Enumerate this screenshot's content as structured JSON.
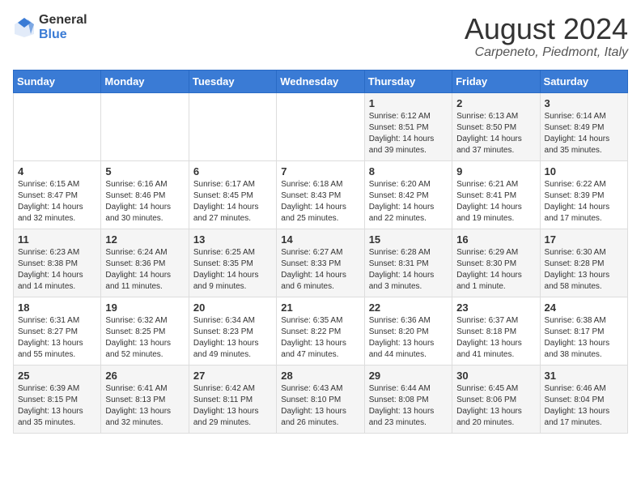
{
  "logo": {
    "general": "General",
    "blue": "Blue"
  },
  "title": {
    "month_year": "August 2024",
    "location": "Carpeneto, Piedmont, Italy"
  },
  "days_of_week": [
    "Sunday",
    "Monday",
    "Tuesday",
    "Wednesday",
    "Thursday",
    "Friday",
    "Saturday"
  ],
  "weeks": [
    [
      {
        "date": "",
        "info": ""
      },
      {
        "date": "",
        "info": ""
      },
      {
        "date": "",
        "info": ""
      },
      {
        "date": "",
        "info": ""
      },
      {
        "date": "1",
        "info": "Sunrise: 6:12 AM\nSunset: 8:51 PM\nDaylight: 14 hours\nand 39 minutes."
      },
      {
        "date": "2",
        "info": "Sunrise: 6:13 AM\nSunset: 8:50 PM\nDaylight: 14 hours\nand 37 minutes."
      },
      {
        "date": "3",
        "info": "Sunrise: 6:14 AM\nSunset: 8:49 PM\nDaylight: 14 hours\nand 35 minutes."
      }
    ],
    [
      {
        "date": "4",
        "info": "Sunrise: 6:15 AM\nSunset: 8:47 PM\nDaylight: 14 hours\nand 32 minutes."
      },
      {
        "date": "5",
        "info": "Sunrise: 6:16 AM\nSunset: 8:46 PM\nDaylight: 14 hours\nand 30 minutes."
      },
      {
        "date": "6",
        "info": "Sunrise: 6:17 AM\nSunset: 8:45 PM\nDaylight: 14 hours\nand 27 minutes."
      },
      {
        "date": "7",
        "info": "Sunrise: 6:18 AM\nSunset: 8:43 PM\nDaylight: 14 hours\nand 25 minutes."
      },
      {
        "date": "8",
        "info": "Sunrise: 6:20 AM\nSunset: 8:42 PM\nDaylight: 14 hours\nand 22 minutes."
      },
      {
        "date": "9",
        "info": "Sunrise: 6:21 AM\nSunset: 8:41 PM\nDaylight: 14 hours\nand 19 minutes."
      },
      {
        "date": "10",
        "info": "Sunrise: 6:22 AM\nSunset: 8:39 PM\nDaylight: 14 hours\nand 17 minutes."
      }
    ],
    [
      {
        "date": "11",
        "info": "Sunrise: 6:23 AM\nSunset: 8:38 PM\nDaylight: 14 hours\nand 14 minutes."
      },
      {
        "date": "12",
        "info": "Sunrise: 6:24 AM\nSunset: 8:36 PM\nDaylight: 14 hours\nand 11 minutes."
      },
      {
        "date": "13",
        "info": "Sunrise: 6:25 AM\nSunset: 8:35 PM\nDaylight: 14 hours\nand 9 minutes."
      },
      {
        "date": "14",
        "info": "Sunrise: 6:27 AM\nSunset: 8:33 PM\nDaylight: 14 hours\nand 6 minutes."
      },
      {
        "date": "15",
        "info": "Sunrise: 6:28 AM\nSunset: 8:31 PM\nDaylight: 14 hours\nand 3 minutes."
      },
      {
        "date": "16",
        "info": "Sunrise: 6:29 AM\nSunset: 8:30 PM\nDaylight: 14 hours\nand 1 minute."
      },
      {
        "date": "17",
        "info": "Sunrise: 6:30 AM\nSunset: 8:28 PM\nDaylight: 13 hours\nand 58 minutes."
      }
    ],
    [
      {
        "date": "18",
        "info": "Sunrise: 6:31 AM\nSunset: 8:27 PM\nDaylight: 13 hours\nand 55 minutes."
      },
      {
        "date": "19",
        "info": "Sunrise: 6:32 AM\nSunset: 8:25 PM\nDaylight: 13 hours\nand 52 minutes."
      },
      {
        "date": "20",
        "info": "Sunrise: 6:34 AM\nSunset: 8:23 PM\nDaylight: 13 hours\nand 49 minutes."
      },
      {
        "date": "21",
        "info": "Sunrise: 6:35 AM\nSunset: 8:22 PM\nDaylight: 13 hours\nand 47 minutes."
      },
      {
        "date": "22",
        "info": "Sunrise: 6:36 AM\nSunset: 8:20 PM\nDaylight: 13 hours\nand 44 minutes."
      },
      {
        "date": "23",
        "info": "Sunrise: 6:37 AM\nSunset: 8:18 PM\nDaylight: 13 hours\nand 41 minutes."
      },
      {
        "date": "24",
        "info": "Sunrise: 6:38 AM\nSunset: 8:17 PM\nDaylight: 13 hours\nand 38 minutes."
      }
    ],
    [
      {
        "date": "25",
        "info": "Sunrise: 6:39 AM\nSunset: 8:15 PM\nDaylight: 13 hours\nand 35 minutes."
      },
      {
        "date": "26",
        "info": "Sunrise: 6:41 AM\nSunset: 8:13 PM\nDaylight: 13 hours\nand 32 minutes."
      },
      {
        "date": "27",
        "info": "Sunrise: 6:42 AM\nSunset: 8:11 PM\nDaylight: 13 hours\nand 29 minutes."
      },
      {
        "date": "28",
        "info": "Sunrise: 6:43 AM\nSunset: 8:10 PM\nDaylight: 13 hours\nand 26 minutes."
      },
      {
        "date": "29",
        "info": "Sunrise: 6:44 AM\nSunset: 8:08 PM\nDaylight: 13 hours\nand 23 minutes."
      },
      {
        "date": "30",
        "info": "Sunrise: 6:45 AM\nSunset: 8:06 PM\nDaylight: 13 hours\nand 20 minutes."
      },
      {
        "date": "31",
        "info": "Sunrise: 6:46 AM\nSunset: 8:04 PM\nDaylight: 13 hours\nand 17 minutes."
      }
    ]
  ]
}
